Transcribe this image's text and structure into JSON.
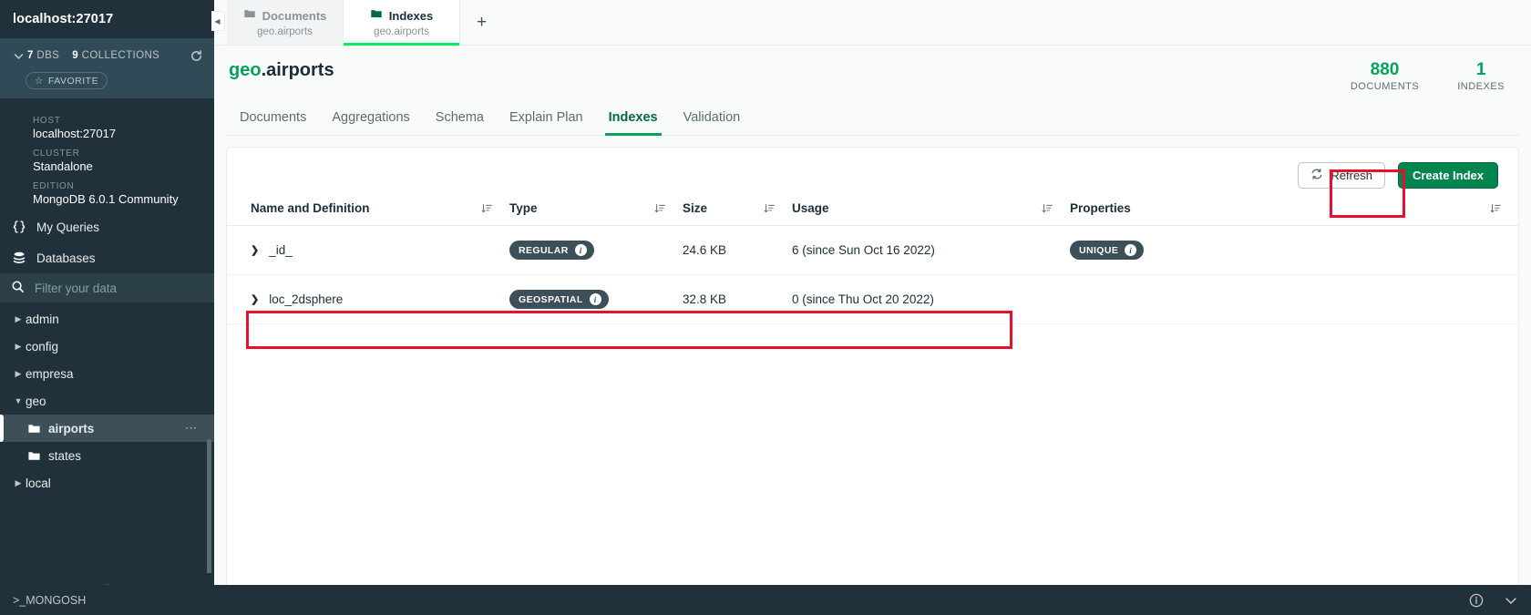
{
  "sidebar": {
    "connection_title": "localhost:27017",
    "db_count": "7",
    "db_label": "DBS",
    "collection_count": "9",
    "collection_label": "COLLECTIONS",
    "favorite_label": "FAVORITE",
    "info": [
      {
        "label": "HOST",
        "value": "localhost:27017"
      },
      {
        "label": "CLUSTER",
        "value": "Standalone"
      },
      {
        "label": "EDITION",
        "value": "MongoDB 6.0.1 Community"
      }
    ],
    "nav": [
      {
        "label": "My Queries",
        "icon": "braces-icon"
      },
      {
        "label": "Databases",
        "icon": "database-icon"
      }
    ],
    "filter_placeholder": "Filter your data",
    "tree": [
      {
        "label": "admin",
        "level": 0,
        "expanded": false,
        "active": false
      },
      {
        "label": "config",
        "level": 0,
        "expanded": false,
        "active": false
      },
      {
        "label": "empresa",
        "level": 0,
        "expanded": false,
        "active": false
      },
      {
        "label": "geo",
        "level": 0,
        "expanded": true,
        "active": false
      },
      {
        "label": "airports",
        "level": 1,
        "expanded": false,
        "active": true
      },
      {
        "label": "states",
        "level": 1,
        "expanded": false,
        "active": false
      },
      {
        "label": "local",
        "level": 0,
        "expanded": false,
        "active": false
      }
    ],
    "add_label": "+"
  },
  "tabs": [
    {
      "name": "Documents",
      "subtitle": "geo.airports",
      "active": false
    },
    {
      "name": "Indexes",
      "subtitle": "geo.airports",
      "active": true
    }
  ],
  "new_tab_label": "+",
  "collection": {
    "namespace_db": "geo",
    "namespace_coll": ".airports",
    "stats": [
      {
        "value": "880",
        "label": "DOCUMENTS"
      },
      {
        "value": "1",
        "label": "INDEXES"
      }
    ],
    "subtabs": [
      {
        "label": "Documents",
        "active": false
      },
      {
        "label": "Aggregations",
        "active": false
      },
      {
        "label": "Schema",
        "active": false
      },
      {
        "label": "Explain Plan",
        "active": false
      },
      {
        "label": "Indexes",
        "active": true
      },
      {
        "label": "Validation",
        "active": false
      }
    ]
  },
  "toolbar": {
    "refresh_label": "Refresh",
    "create_index_label": "Create Index"
  },
  "index_table": {
    "columns": [
      {
        "label": "Name and Definition",
        "sortable": true
      },
      {
        "label": "Type",
        "sortable": true
      },
      {
        "label": "Size",
        "sortable": true
      },
      {
        "label": "Usage",
        "sortable": true
      },
      {
        "label": "Properties",
        "sortable": true
      }
    ],
    "rows": [
      {
        "name": "_id_",
        "type": "REGULAR",
        "size": "24.6 KB",
        "usage": "6 (since Sun Oct 16 2022)",
        "properties": "UNIQUE",
        "highlighted": false
      },
      {
        "name": "loc_2dsphere",
        "type": "GEOSPATIAL",
        "size": "32.8 KB",
        "usage": "0 (since Thu Oct 20 2022)",
        "properties": "",
        "highlighted": true
      }
    ]
  },
  "statusbar": {
    "shell_label": ">_MONGOSH",
    "info_icon": "info-icon",
    "chevron_icon": "chevron-down-icon"
  },
  "colors": {
    "accent_green": "#00A35C",
    "button_green": "#00854F",
    "sidebar_bg": "#21313C",
    "annotation_red": "#E8112D",
    "badge_dark": "#3D4F58"
  }
}
